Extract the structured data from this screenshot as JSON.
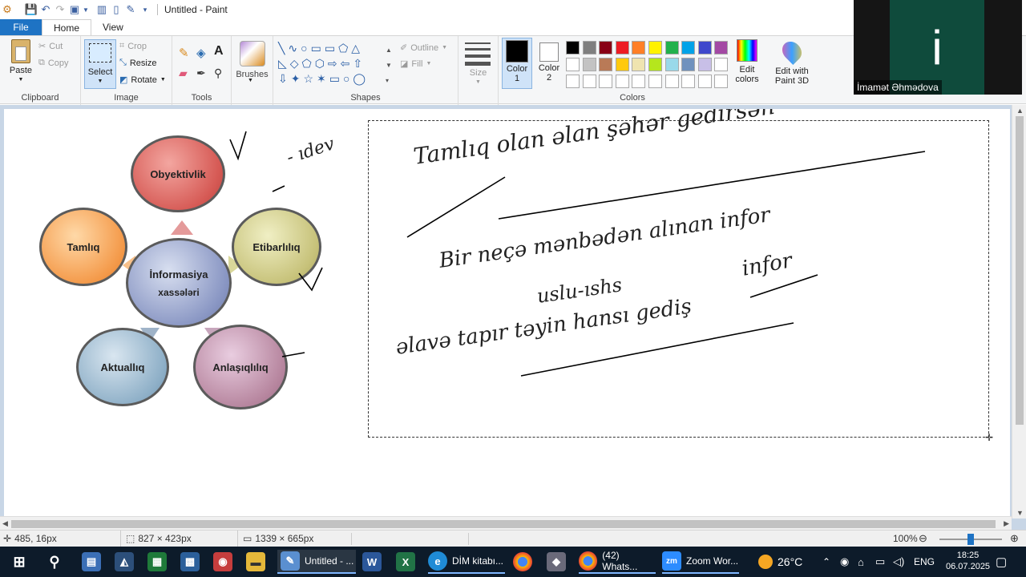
{
  "window": {
    "title": "Untitled - Paint"
  },
  "tabs": [
    {
      "label": "File"
    },
    {
      "label": "Home"
    },
    {
      "label": "View"
    }
  ],
  "ribbon": {
    "clipboard": {
      "label": "Clipboard",
      "paste": "Paste",
      "cut": "Cut",
      "copy": "Copy"
    },
    "image": {
      "label": "Image",
      "select": "Select",
      "crop": "Crop",
      "resize": "Resize",
      "rotate": "Rotate"
    },
    "tools": {
      "label": "Tools"
    },
    "brushes": {
      "label": "Brushes"
    },
    "shapes": {
      "label": "Shapes",
      "outline": "Outline",
      "fill": "Fill"
    },
    "size": {
      "label": "Size"
    },
    "colors": {
      "label": "Colors",
      "color1": "Color\n1",
      "color1_line1": "Color",
      "color1_line2": "1",
      "color2_line1": "Color",
      "color2_line2": "2",
      "edit": "Edit\ncolors",
      "edit_line1": "Edit",
      "edit_line2": "colors",
      "palette_row1": [
        "#000000",
        "#7f7f7f",
        "#880015",
        "#ed1c24",
        "#ff7f27",
        "#fff200",
        "#22b14c",
        "#00a2e8",
        "#3f48cc",
        "#a349a4"
      ],
      "palette_row2": [
        "#ffffff",
        "#c3c3c3",
        "#b97a57",
        "#ffc90e",
        "#efe4b0",
        "#b5e61d",
        "#99d9ea",
        "#7092be",
        "#c8bfe7",
        "#ffffff"
      ]
    },
    "paint3d": {
      "line1": "Edit with",
      "line2": "Paint 3D"
    }
  },
  "diagram": {
    "center": {
      "line1": "İnformasiya",
      "line2": "xassələri"
    },
    "nodes": {
      "top": "Obyektivlik",
      "left": "Tamlıq",
      "right": "Etibarlılıq",
      "bottom_left": "Aktuallıq",
      "bottom_right": "Anlaşıqlılıq"
    }
  },
  "handwriting": {
    "side_note": "- ıdev",
    "line1": "Tamlıq   olan əlan şəhər gedirsən",
    "line2": "Bir neçə mənbədən alınan infor",
    "line3": "uslu-ıshs",
    "line4": "infor",
    "line5": "əlavə tapır  təyin   hansı gediş"
  },
  "status": {
    "cursor": "485, 16px",
    "selection": "827 × 423px",
    "canvas_size": "1339 × 665px",
    "zoom": "100%"
  },
  "taskbar": {
    "apps": [
      {
        "label": "Untitled - ..."
      },
      {
        "label": "DİM kitabı..."
      },
      {
        "label": "(42) Whats..."
      },
      {
        "label": "Zoom Wor..."
      }
    ],
    "weather": "26°C",
    "lang": "ENG",
    "time": "18:25",
    "date": "06.07.2025"
  },
  "video": {
    "initial": "i",
    "name": "İmamət Əhmədova"
  }
}
